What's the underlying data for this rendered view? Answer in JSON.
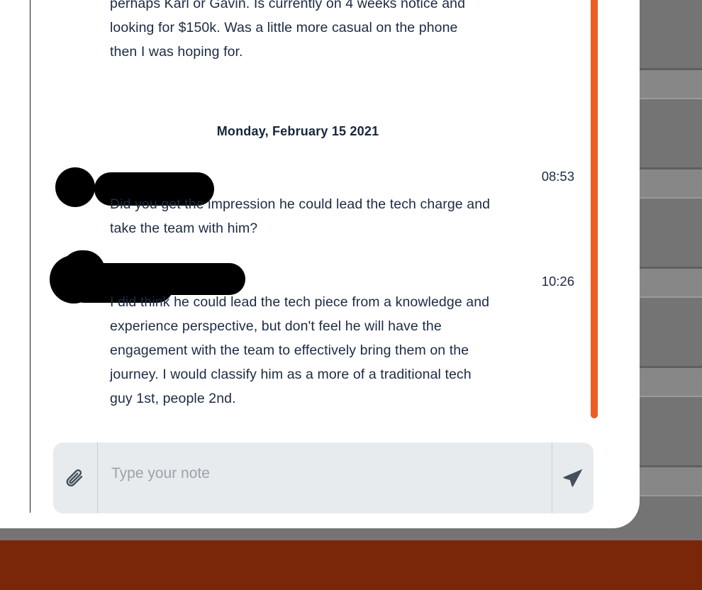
{
  "colors": {
    "scrollbar": "#ef5c23",
    "bottom_bar": "#7a2709",
    "background_panel": "#7a7a7a",
    "card": "#ffffff",
    "text": "#1d2a44",
    "composer_background": "#e7ebee",
    "placeholder": "#9ba2a9"
  },
  "thread": {
    "top_message": {
      "text": "perhaps Karl or Gavin. Is currently on 4 weeks notice and looking for $150k. Was a little more casual on the phone then I was hoping for."
    },
    "date_divider": {
      "label": "Monday, February 15 2021"
    },
    "messages": [
      {
        "author": "",
        "time": "08:53",
        "text": "Did you get the impression he could lead the tech charge and take the team with him?",
        "redacted": true
      },
      {
        "author": "",
        "time": "10:26",
        "text": "I did think he could lead the tech piece from a knowledge and experience perspective, but don't feel he will have the engagement with the team to effectively bring them on the journey. I would classify him as a more of a traditional tech guy 1st, people 2nd.",
        "redacted": true
      }
    ]
  },
  "composer": {
    "placeholder": "Type your note",
    "value": "",
    "attach_icon": "paperclip-icon",
    "send_icon": "send-paper-plane-icon"
  }
}
